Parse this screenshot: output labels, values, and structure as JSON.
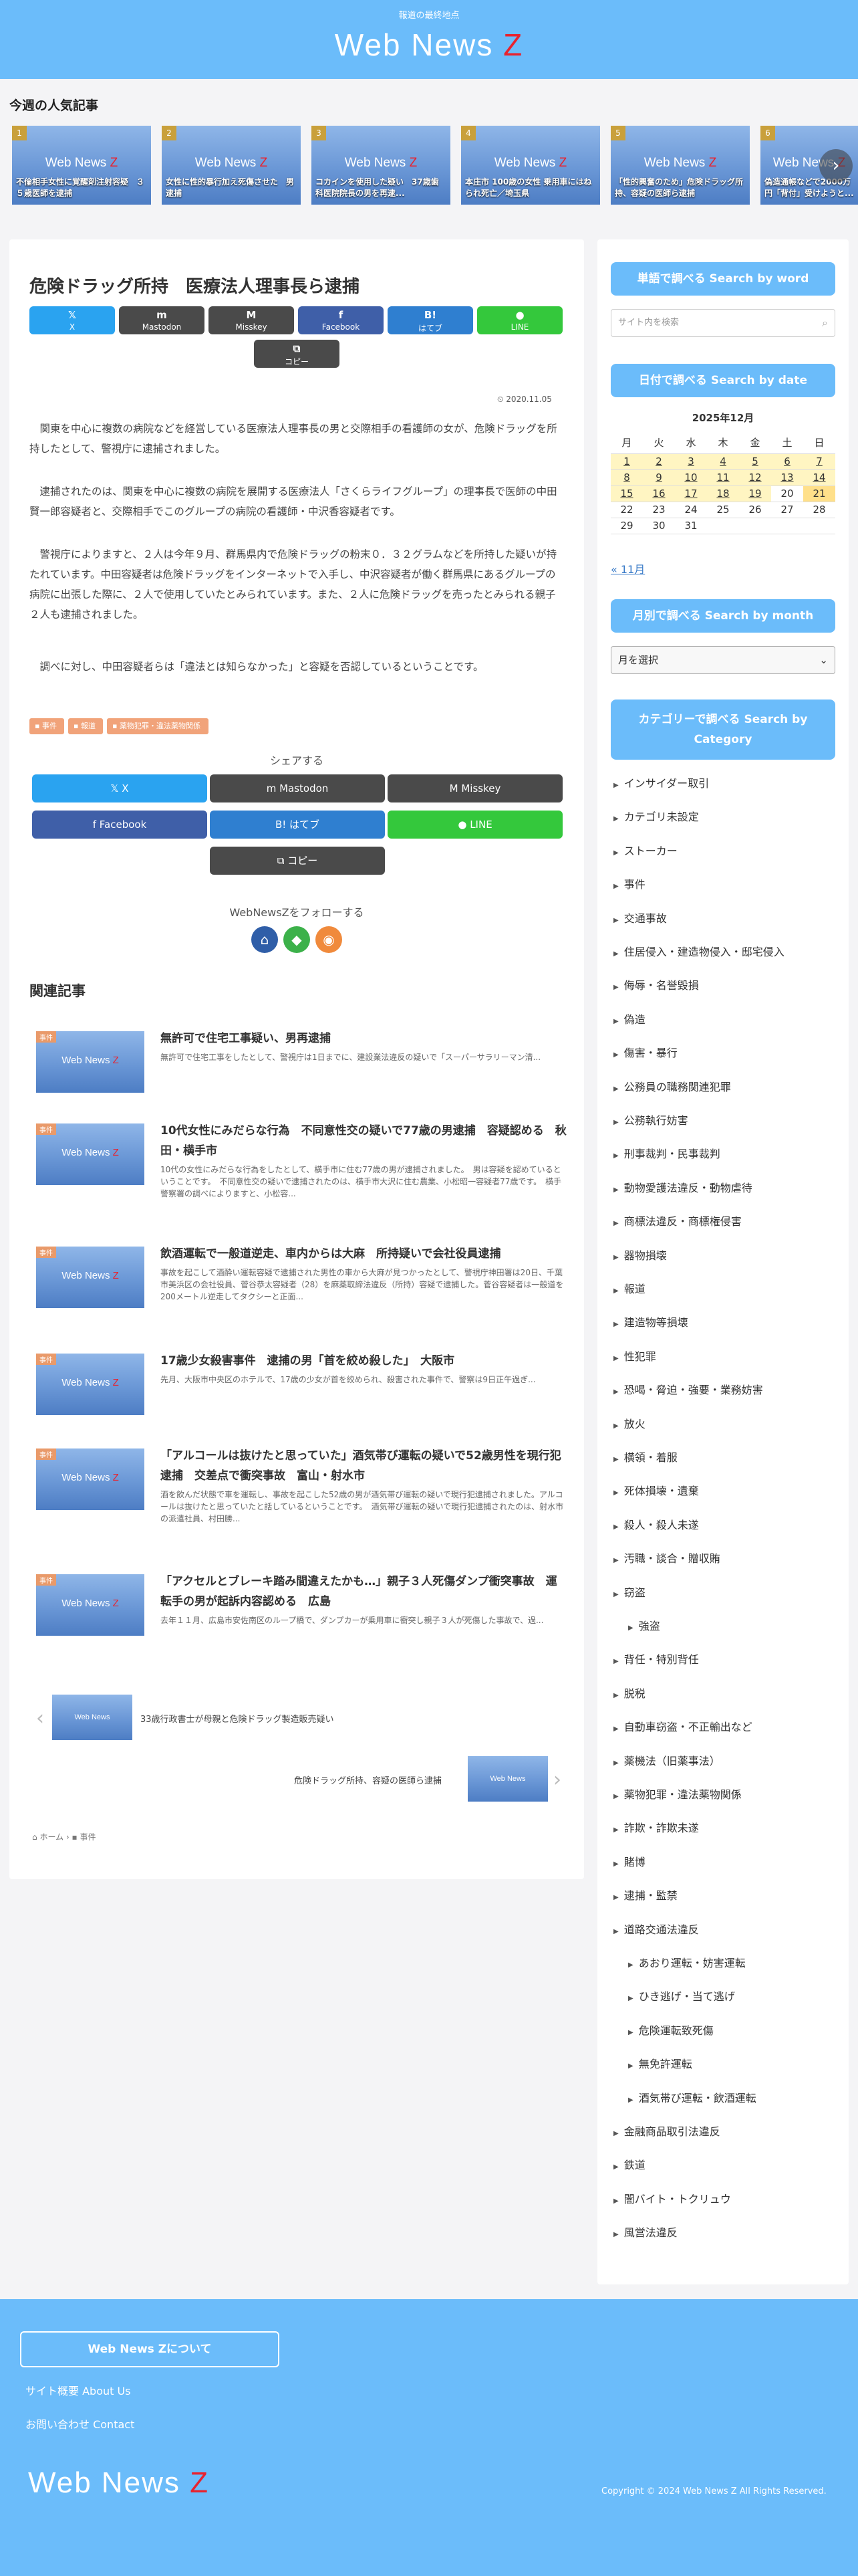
{
  "header": {
    "tagline": "報道の最終地点",
    "logo_text": "Web News ",
    "logo_z": "Z"
  },
  "popular": {
    "title": "今週の人気記事",
    "logo_text": "Web News ",
    "logo_z": "Z",
    "items": [
      {
        "num": "1",
        "caption": "不倫相手女性に覚醒剤注射容疑　３５歳医師を逮捕"
      },
      {
        "num": "2",
        "caption": "女性に性的暴行加え死傷させた　男逮捕"
      },
      {
        "num": "3",
        "caption": "コカインを使用した疑い　37歳歯科医院院長の男を再逮..."
      },
      {
        "num": "4",
        "caption": "本庄市 100歳の女性 乗用車にはねられ死亡／埼玉県"
      },
      {
        "num": "5",
        "caption": "「性的興奮のため」危険ドラッグ所持、容疑の医師ら逮捕"
      },
      {
        "num": "6",
        "caption": "偽造通帳などで2000万円「背付」受けようと..."
      }
    ]
  },
  "article": {
    "title": "危険ドラッグ所持　医療法人理事長ら逮捕",
    "date": "2020.11.05",
    "share_buttons": [
      {
        "icon": "𝕏",
        "label": "X"
      },
      {
        "icon": "m",
        "label": "Mastodon"
      },
      {
        "icon": "M",
        "label": "Misskey"
      },
      {
        "icon": "f",
        "label": "Facebook"
      },
      {
        "icon": "B!",
        "label": "はてブ"
      },
      {
        "icon": "●",
        "label": "LINE"
      },
      {
        "icon": "⧉",
        "label": "コピー"
      }
    ],
    "paragraphs": [
      "　関東を中心に複数の病院などを経営している医療法人理事長の男と交際相手の看護師の女が、危険ドラッグを所持したとして、警視庁に逮捕されました。",
      "　逮捕されたのは、関東を中心に複数の病院を展開する医療法人「さくらライフグループ」の理事長で医師の中田賢一郎容疑者と、交際相手でこのグループの病院の看護師・中沢香容疑者です。",
      "　警視庁によりますと、２人は今年９月、群馬県内で危険ドラッグの粉末０．３２グラムなどを所持した疑いが持たれています。中田容疑者は危険ドラッグをインターネットで入手し、中沢容疑者が働く群馬県にあるグループの病院に出張した際に、２人で使用していたとみられています。また、２人に危険ドラッグを売ったとみられる親子２人も逮捕されました。",
      "　調べに対し、中田容疑者らは「違法とは知らなかった」と容疑を否認しているということです。"
    ],
    "tags": [
      "事件",
      "報道",
      "薬物犯罪・違法薬物関係"
    ],
    "share_title": "シェアする",
    "share_large": [
      {
        "icon": "𝕏",
        "label": "X"
      },
      {
        "icon": "m",
        "label": "Mastodon"
      },
      {
        "icon": "M",
        "label": "Misskey"
      },
      {
        "icon": "f",
        "label": "Facebook"
      },
      {
        "icon": "B!",
        "label": "はてブ"
      },
      {
        "icon": "●",
        "label": "LINE"
      },
      {
        "icon": "⧉",
        "label": "コピー"
      }
    ],
    "follow_title": "WebNewsZをフォローする",
    "follow_icons": [
      {
        "name": "home-icon",
        "glyph": "⌂",
        "color": "#2f5ea8"
      },
      {
        "name": "feedly-icon",
        "glyph": "◆",
        "color": "#3cb14a"
      },
      {
        "name": "rss-icon",
        "glyph": "◉",
        "color": "#f08a3c"
      }
    ],
    "related_title": "関連記事",
    "related": [
      {
        "cat": "事件",
        "title": "無許可で住宅工事疑い、男再逮捕",
        "summary": "無許可で住宅工事をしたとして、警視庁は1日までに、建設業法違反の疑いで「スーパーサラリーマン清..."
      },
      {
        "cat": "事件",
        "title": "10代女性にみだらな行為　不同意性交の疑いで77歳の男逮捕　容疑認める　秋田・横手市",
        "summary": "10代の女性にみだらな行為をしたとして、横手市に住む77歳の男が逮捕されました。　男は容疑を認めているということです。　不同意性交の疑いで逮捕されたのは、横手市大沢に住む農業、小松昭一容疑者77歳です。　横手警察署の調べによりますと、小松容..."
      },
      {
        "cat": "事件",
        "title": "飲酒運転で一般道逆走、車内からは大麻　所持疑いで会社役員逮捕",
        "summary": "事故を起こして酒酔い運転容疑で逮捕された男性の車から大麻が見つかったとして、警視庁神田署は20日、千葉市美浜区の会社役員、菅谷恭太容疑者（28）を麻薬取締法違反（所持）容疑で逮捕した。菅谷容疑者は一般道を200メートル逆走してタクシーと正面..."
      },
      {
        "cat": "事件",
        "title": "17歳少女殺害事件　逮捕の男「首を絞め殺した」　大阪市",
        "summary": "先月、大阪市中央区のホテルで、17歳の少女が首を絞められ、殺害された事件で、警察は9日正午過ぎ..."
      },
      {
        "cat": "事件",
        "title": "「アルコールは抜けたと思っていた」酒気帯び運転の疑いで52歳男性を現行犯逮捕　交差点で衝突事故　富山・射水市",
        "summary": "酒を飲んだ状態で車を運転し、事故を起こした52歳の男が酒気帯び運転の疑いで現行犯逮捕されました。アルコールは抜けたと思っていたと話しているということです。　酒気帯び運転の疑いで現行犯逮捕されたのは、射水市の派遣社員、村田勝..."
      },
      {
        "cat": "事件",
        "title": "「アクセルとブレーキ踏み間違えたかも…」親子３人死傷ダンプ衝突事故　運転手の男が起訴内容認める　広島",
        "summary": "去年１１月、広島市安佐南区のループ橋で、ダンプカーが乗用車に衝突し親子３人が死傷した事故で、過..."
      }
    ],
    "prev_post": "33歳行政書士が母親と危険ドラッグ製造販売疑い",
    "next_post": "危険ドラッグ所持、容疑の医師ら逮捕",
    "thumb_text": "Web News",
    "breadcrumb": [
      "ホーム",
      "事件"
    ]
  },
  "sidebar": {
    "search_heading": "単語で調べる Search by word",
    "search_placeholder": "サイト内を検索",
    "date_heading": "日付で調べる Search by date",
    "calendar_title": "2025年12月",
    "weekdays": [
      "月",
      "火",
      "水",
      "木",
      "金",
      "土",
      "日"
    ],
    "calendar_rows": [
      [
        "1",
        "2",
        "3",
        "4",
        "5",
        "6",
        "7"
      ],
      [
        "8",
        "9",
        "10",
        "11",
        "12",
        "13",
        "14"
      ],
      [
        "15",
        "16",
        "17",
        "18",
        "19",
        "20",
        "21"
      ],
      [
        "22",
        "23",
        "24",
        "25",
        "26",
        "27",
        "28"
      ],
      [
        "29",
        "30",
        "31",
        "",
        "",
        "",
        ""
      ]
    ],
    "prev_month": "« 11月",
    "month_heading": "月別で調べる Search by month",
    "month_select": "月を選択",
    "category_heading": "カテゴリーで調べる Search by Category",
    "categories": [
      {
        "label": "インサイダー取引",
        "sub": false
      },
      {
        "label": "カテゴリ未設定",
        "sub": false
      },
      {
        "label": "ストーカー",
        "sub": false
      },
      {
        "label": "事件",
        "sub": false
      },
      {
        "label": "交通事故",
        "sub": false
      },
      {
        "label": "住居侵入・建造物侵入・邸宅侵入",
        "sub": false
      },
      {
        "label": "侮辱・名誉毀損",
        "sub": false
      },
      {
        "label": "偽造",
        "sub": false
      },
      {
        "label": "傷害・暴行",
        "sub": false
      },
      {
        "label": "公務員の職務関連犯罪",
        "sub": false
      },
      {
        "label": "公務執行妨害",
        "sub": false
      },
      {
        "label": "刑事裁判・民事裁判",
        "sub": false
      },
      {
        "label": "動物愛護法違反・動物虐待",
        "sub": false
      },
      {
        "label": "商標法違反・商標権侵害",
        "sub": false
      },
      {
        "label": "器物損壊",
        "sub": false
      },
      {
        "label": "報道",
        "sub": false
      },
      {
        "label": "建造物等損壊",
        "sub": false
      },
      {
        "label": "性犯罪",
        "sub": false
      },
      {
        "label": "恐喝・脅迫・強要・業務妨害",
        "sub": false
      },
      {
        "label": "放火",
        "sub": false
      },
      {
        "label": "横領・着服",
        "sub": false
      },
      {
        "label": "死体損壊・遺棄",
        "sub": false
      },
      {
        "label": "殺人・殺人未遂",
        "sub": false
      },
      {
        "label": "汚職・談合・贈収賄",
        "sub": false
      },
      {
        "label": "窃盗",
        "sub": false
      },
      {
        "label": "強盗",
        "sub": true
      },
      {
        "label": "背任・特別背任",
        "sub": false
      },
      {
        "label": "脱税",
        "sub": false
      },
      {
        "label": "自動車窃盗・不正輸出など",
        "sub": false
      },
      {
        "label": "薬機法（旧薬事法）",
        "sub": false
      },
      {
        "label": "薬物犯罪・違法薬物関係",
        "sub": false
      },
      {
        "label": "詐欺・詐欺未遂",
        "sub": false
      },
      {
        "label": "賭博",
        "sub": false
      },
      {
        "label": "逮捕・監禁",
        "sub": false
      },
      {
        "label": "道路交通法違反",
        "sub": false
      },
      {
        "label": "あおり運転・妨害運転",
        "sub": true
      },
      {
        "label": "ひき逃げ・当て逃げ",
        "sub": true
      },
      {
        "label": "危険運転致死傷",
        "sub": true
      },
      {
        "label": "無免許運転",
        "sub": true
      },
      {
        "label": "酒気帯び運転・飲酒運転",
        "sub": true
      },
      {
        "label": "金融商品取引法違反",
        "sub": false
      },
      {
        "label": "鉄道",
        "sub": false
      },
      {
        "label": "闇バイト・トクリュウ",
        "sub": false
      },
      {
        "label": "風営法違反",
        "sub": false
      }
    ]
  },
  "footer": {
    "about_button": "Web News Zについて",
    "links": [
      "サイト概要 About Us",
      "お問い合わせ Contact"
    ],
    "logo_text": "Web News ",
    "logo_z": "Z",
    "copyright": "Copyright © 2024 Web News Z All Rights Reserved."
  }
}
